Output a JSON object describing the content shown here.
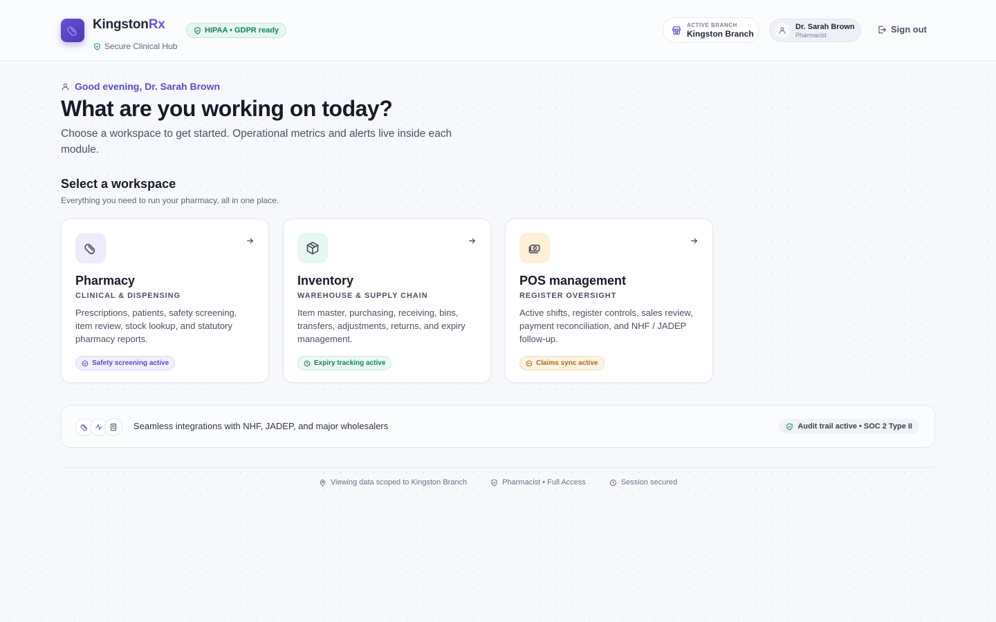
{
  "header": {
    "brand": {
      "name_part1": "Kingston",
      "name_part2": "Rx",
      "subtitle": "Secure Clinical Hub"
    },
    "compliance_badge": "HIPAA • GDPR ready",
    "branch": {
      "label": "ACTIVE BRANCH",
      "name": "Kingston Branch"
    },
    "user": {
      "name": "Dr. Sarah Brown",
      "role": "Pharmacist"
    },
    "signout_label": "Sign out"
  },
  "intro": {
    "greeting": "Good evening, Dr. Sarah Brown",
    "title": "What are you working on today?",
    "subtitle": "Choose a workspace to get started. Operational metrics and alerts live inside each module."
  },
  "workspaces": {
    "title": "Select a workspace",
    "subtitle": "Everything you need to run your pharmacy, all in one place.",
    "cards": [
      {
        "title": "Pharmacy",
        "category": "CLINICAL & DISPENSING",
        "description": "Prescriptions, patients, safety screening, item review, stock lookup, and statutory pharmacy reports.",
        "badge": "Safety screening active",
        "icon": "pill-icon",
        "accent": "#5b4cc8"
      },
      {
        "title": "Inventory",
        "category": "WAREHOUSE & SUPPLY CHAIN",
        "description": "Item master, purchasing, receiving, bins, transfers, adjustments, returns, and expiry management.",
        "badge": "Expiry tracking active",
        "icon": "package-icon",
        "accent": "#16855a"
      },
      {
        "title": "POS management",
        "category": "REGISTER OVERSIGHT",
        "description": "Active shifts, register controls, sales review, payment reconciliation, and NHF / JADEP follow-up.",
        "badge": "Claims sync active",
        "icon": "cash-register-icon",
        "accent": "#b8680c"
      }
    ]
  },
  "integrations": {
    "text": "Seamless integrations with NHF, JADEP, and major wholesalers",
    "badge": "Audit trail active • SOC 2 Type II"
  },
  "footer": {
    "scope": "Viewing data scoped to Kingston Branch",
    "access": "Pharmacist • Full Access",
    "session": "Session secured"
  }
}
